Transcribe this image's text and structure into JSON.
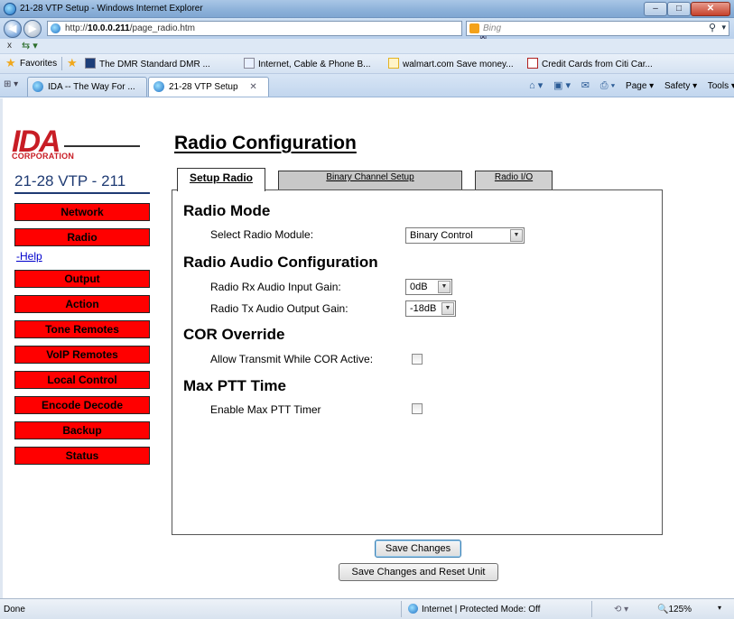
{
  "window": {
    "title": "21-28 VTP Setup - Windows Internet Explorer",
    "minimize": "–",
    "maximize": "□",
    "close": "✕"
  },
  "address": {
    "url_prefix": "http://",
    "url_host": "10.0.0.211",
    "url_path": "/page_radio.htm",
    "tools": "▾ ⊠ ✦",
    "stop": "✕",
    "search_placeholder": "Bing",
    "search_icon": "⚲",
    "search_drop": "▾",
    "back": "◀",
    "forward": "▶"
  },
  "cmdbar_top": {
    "close": "x",
    "convert": "⇆ ▾"
  },
  "favorites": {
    "label": "Favorites",
    "links": [
      "The DMR Standard DMR ...",
      "Internet, Cable & Phone B...",
      "walmart.com Save money...",
      "Credit Cards from Citi Car..."
    ]
  },
  "tabs_browser": {
    "quick_tabs": "⊞ ▾",
    "tab1": "IDA -- The Way For ...",
    "tab2": "21-28 VTP Setup",
    "tab_close": "✕"
  },
  "command_bar": {
    "home": "⌂ ▾",
    "feeds": "▣ ▾",
    "mail": "✉",
    "print": "⎙ ▾",
    "page": "Page ▾",
    "safety": "Safety ▾",
    "tools": "Tools ▾",
    "help": "?"
  },
  "logo": {
    "brand": "IDA",
    "sub": "CORPORATION"
  },
  "unit_name": "21-28 VTP - 211",
  "nav": {
    "items": [
      "Network",
      "Radio",
      "Output",
      "Action",
      "Tone Remotes",
      "VoIP Remotes",
      "Local Control",
      "Encode Decode",
      "Backup",
      "Status"
    ],
    "help": "-Help"
  },
  "page": {
    "title": "Radio Configuration",
    "tabs": [
      "Setup Radio",
      "Binary Channel Setup",
      "Radio I/O"
    ]
  },
  "sections": {
    "radio_mode": {
      "title": "Radio Mode",
      "module_label": "Select Radio Module:",
      "module_value": "Binary Control"
    },
    "audio": {
      "title": "Radio Audio Configuration",
      "rx_label": "Radio Rx Audio Input Gain:",
      "rx_value": "0dB",
      "tx_label": "Radio Tx Audio Output Gain:",
      "tx_value": "-18dB"
    },
    "cor": {
      "title": "COR Override",
      "label": "Allow Transmit While COR Active:",
      "checked": false
    },
    "ptt": {
      "title": "Max PTT Time",
      "label": "Enable Max PTT Timer",
      "checked": false
    }
  },
  "buttons": {
    "save": "Save Changes",
    "save_reset": "Save Changes and Reset Unit"
  },
  "status": {
    "text": "Done",
    "zone": "Internet | Protected Mode: Off",
    "zoom_ctl": "⟲ ▾",
    "zoom": "🔍125%",
    "zoom_drop": "▾"
  },
  "colors": {
    "nav_red": "#ff0000",
    "brand_red": "#c81d25",
    "heading_blue": "#1f3b73",
    "link_blue": "#0000cc"
  }
}
